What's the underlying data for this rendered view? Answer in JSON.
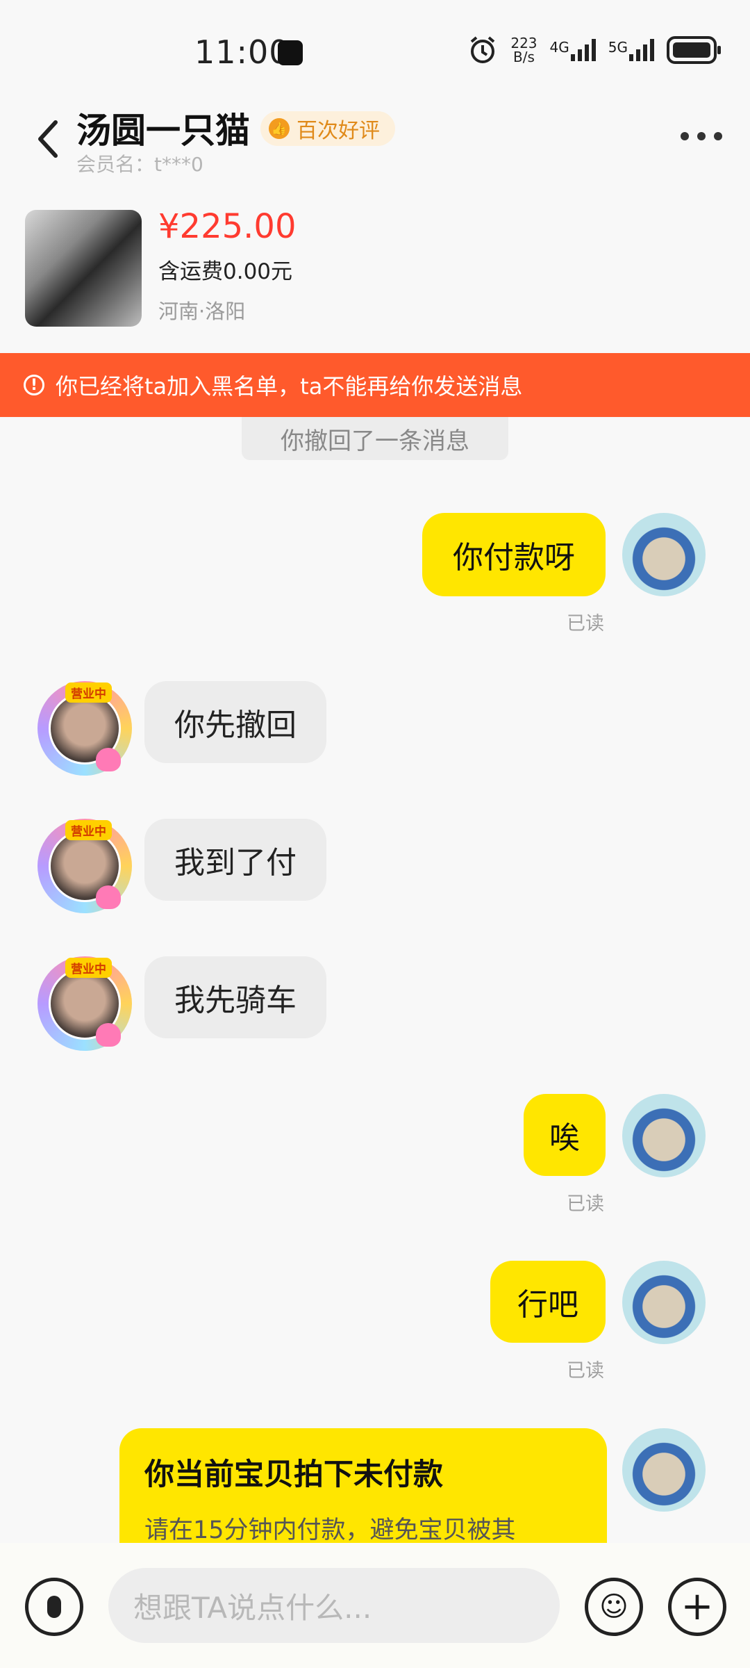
{
  "status_bar": {
    "time": "11:00",
    "net_speed_value": "223",
    "net_speed_unit": "B/s",
    "signal_1": "4G",
    "signal_2": "5G"
  },
  "header": {
    "contact_name": "汤圆一只猫",
    "badge_label": "百次好评",
    "member_label": "会员名：t***0"
  },
  "product": {
    "price": "¥225.00",
    "shipping": "含运费0.00元",
    "location": "河南·洛阳"
  },
  "banner": {
    "text": "你已经将ta加入黑名单，ta不能再给你发送消息"
  },
  "system": {
    "recall_text": "你撤回了一条消息"
  },
  "messages": [
    {
      "from": "me",
      "text": "你付款呀",
      "status": "已读"
    },
    {
      "from": "them",
      "text": "你先撤回"
    },
    {
      "from": "them",
      "text": "我到了付"
    },
    {
      "from": "them",
      "text": "我先骑车"
    },
    {
      "from": "me",
      "text": "唉",
      "status": "已读"
    },
    {
      "from": "me",
      "text": "行吧",
      "status": "已读"
    }
  ],
  "avatar_tag": "营业中",
  "payment_card": {
    "title": "你当前宝贝拍下未付款",
    "subtitle": "请在15分钟内付款，避免宝贝被其"
  },
  "input_bar": {
    "placeholder": "想跟TA说点什么..."
  },
  "colors": {
    "my_bubble": "#ffe600",
    "banner": "#ff5a2c",
    "price": "#ff3b30"
  },
  "icons": [
    "mic-icon",
    "emoji-icon",
    "plus-icon",
    "back-icon",
    "more-icon",
    "alarm-icon",
    "battery-icon"
  ]
}
